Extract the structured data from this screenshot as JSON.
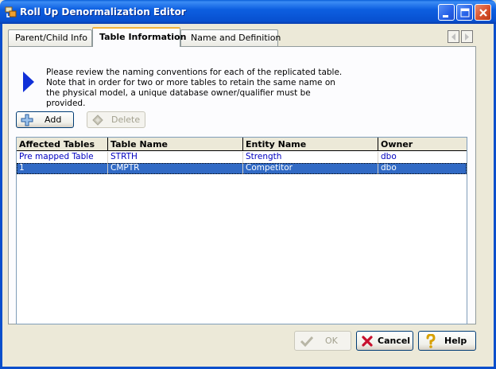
{
  "window": {
    "title": "Roll Up Denormalization Editor"
  },
  "tabs": [
    {
      "label": "Parent/Child Info"
    },
    {
      "label": "Table Information"
    },
    {
      "label": "Name and Definition"
    }
  ],
  "instructions": "Please review the naming conventions for each of the replicated table. Note that in order for two or more tables to retain the same name on the physical model, a unique database owner/qualifier must be provided.",
  "toolbar": {
    "add_label": "Add",
    "delete_label": "Delete"
  },
  "table": {
    "columns": [
      "Affected Tables",
      "Table Name",
      "Entity Name",
      "Owner"
    ],
    "rows": [
      [
        "Pre mapped Table",
        "STRTH",
        "Strength",
        "dbo"
      ],
      [
        "1",
        "CMPTR",
        "Competitor",
        "dbo"
      ]
    ]
  },
  "footer": {
    "ok_label": "OK",
    "cancel_label": "Cancel",
    "help_label": "Help"
  },
  "colors": {
    "titlebar": "#0a5fd8",
    "selection": "#316ac5",
    "row_text": "#0000c0",
    "active_tab_accent": "#f3b43b"
  }
}
